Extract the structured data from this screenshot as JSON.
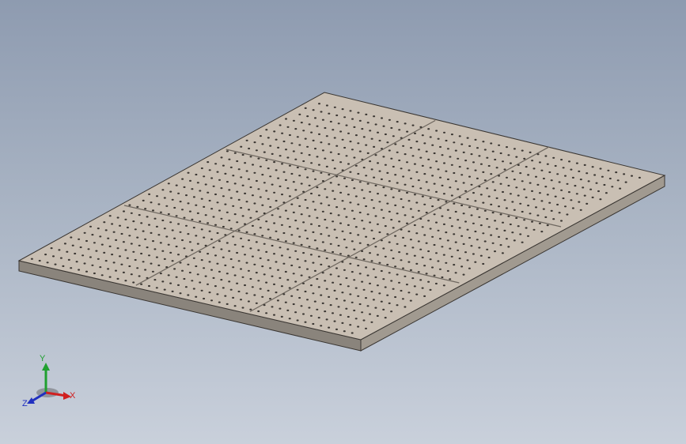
{
  "viewport": {
    "background_top": "#8e9bb0",
    "background_bottom": "#c9d0db"
  },
  "model": {
    "name": "perforated-plate",
    "panel_grid": {
      "rows": 3,
      "cols": 3
    },
    "top_color": "#c9bfb3",
    "edge_front_color": "#8a847c",
    "edge_side_color": "#a19a90",
    "hole_color": "#3a3632"
  },
  "triad": {
    "x_label": "X",
    "y_label": "Y",
    "z_label": "Z",
    "x_color": "#d02020",
    "y_color": "#20a030",
    "z_color": "#2030c0"
  }
}
